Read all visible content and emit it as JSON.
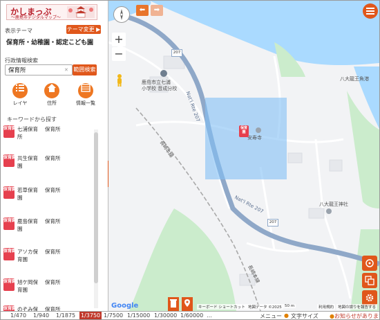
{
  "app": {
    "logo_title": "かしまっぷ",
    "logo_subtitle": "〜鹿島市デジタルマップ〜"
  },
  "sidebar": {
    "theme_label": "表示テーマ",
    "theme_change_button": "テーマ変更 ▶",
    "theme_name": "保育所・幼稚園・認定こども園",
    "admin_search_label": "行政情報検索",
    "search_value": "保育所",
    "search_button": "範囲検索",
    "tools": [
      {
        "label": "レイヤ",
        "icon": "list-icon"
      },
      {
        "label": "住所",
        "icon": "home-icon"
      },
      {
        "label": "情報一覧",
        "icon": "table-icon"
      }
    ],
    "keyword_label": "キーワードから探す",
    "pin_text": "保育園",
    "items": [
      {
        "name": "七浦保育所",
        "type": "保育所"
      },
      {
        "name": "共生保育園",
        "type": "保育所"
      },
      {
        "name": "若草保育園",
        "type": "保育所"
      },
      {
        "name": "鹿島保育園",
        "type": "保育所"
      },
      {
        "name": "アソカ保育園",
        "type": "保育所"
      },
      {
        "name": "旭ケ岡保育園",
        "type": "保育所"
      },
      {
        "name": "のぞみ保育園",
        "type": "保育所"
      }
    ]
  },
  "map": {
    "labels": {
      "school": "鹿島市立七浦\n小学校 音成分校",
      "temple_anjuji": "安寿寺",
      "shrine_gyoko": "八大龍王魚港",
      "shrine_yadai": "八大龍王神社",
      "route_label_1": "Nat'l Rte 207",
      "route_label_2": "Nat'l Rte 207",
      "rail_label_1": "長崎本線",
      "rail_label_2": "長崎本線",
      "shield_1": "207",
      "shield_2": "207",
      "pin_text": "保育園"
    },
    "attribution": {
      "google": "Google",
      "shortcuts": "キーボード ショートカット",
      "map_data": "地図データ ©2025",
      "scale": "50 m",
      "terms": "利用規約",
      "report": "地図の誤りを報告する"
    }
  },
  "footer": {
    "scales": [
      "1/470",
      "1/940",
      "1/1875",
      "1/3750",
      "1/7500",
      "1/15000",
      "1/30000",
      "1/60000"
    ],
    "active_scale": "1/3750",
    "more": "…",
    "menu": "メニュー",
    "font_size": "文字サイズ",
    "notice": "お知らせがあります。"
  },
  "colors": {
    "accent": "#e0571b",
    "pin": "#e6404e",
    "road": "#8fa8c8",
    "water": "#aadaff",
    "park": "#cbeccc",
    "selection": "#82c0f5"
  }
}
